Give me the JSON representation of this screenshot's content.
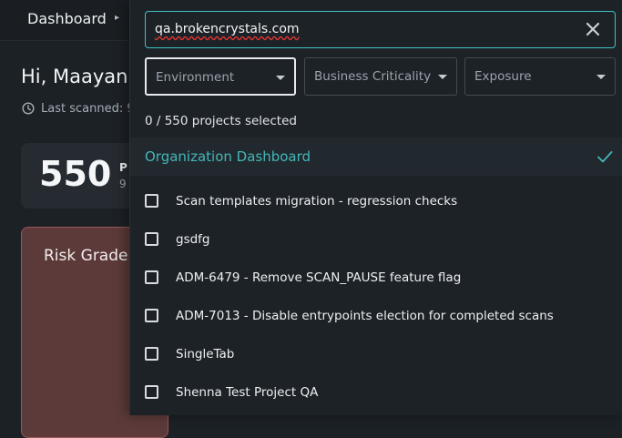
{
  "breadcrumb": {
    "label": "Dashboard"
  },
  "greeting": "Hi, Maayan",
  "last_scanned": "Last scanned: 9",
  "project_count": {
    "value": "550",
    "label": "P",
    "sub": "9"
  },
  "risk_card": {
    "title": "Risk Grade"
  },
  "dropdown": {
    "search_value": "qa.brokencrystals.com",
    "filters": [
      {
        "label": "Environment"
      },
      {
        "label": "Business Criticality"
      },
      {
        "label": "Exposure"
      }
    ],
    "selected_count": "0 / 550 projects selected",
    "organization_option": "Organization Dashboard",
    "projects": [
      {
        "label": "Scan templates migration - regression checks"
      },
      {
        "label": "gsdfg"
      },
      {
        "label": "ADM-6479 - Remove SCAN_PAUSE feature flag"
      },
      {
        "label": "ADM-7013 - Disable entrypoints election for completed scans"
      },
      {
        "label": "SingleTab"
      },
      {
        "label": "Shenna Test Project QA"
      }
    ]
  },
  "colors": {
    "accent": "#3ec3c3",
    "org_text": "#43b6b9",
    "risk_bg": "#5c3a3a"
  }
}
